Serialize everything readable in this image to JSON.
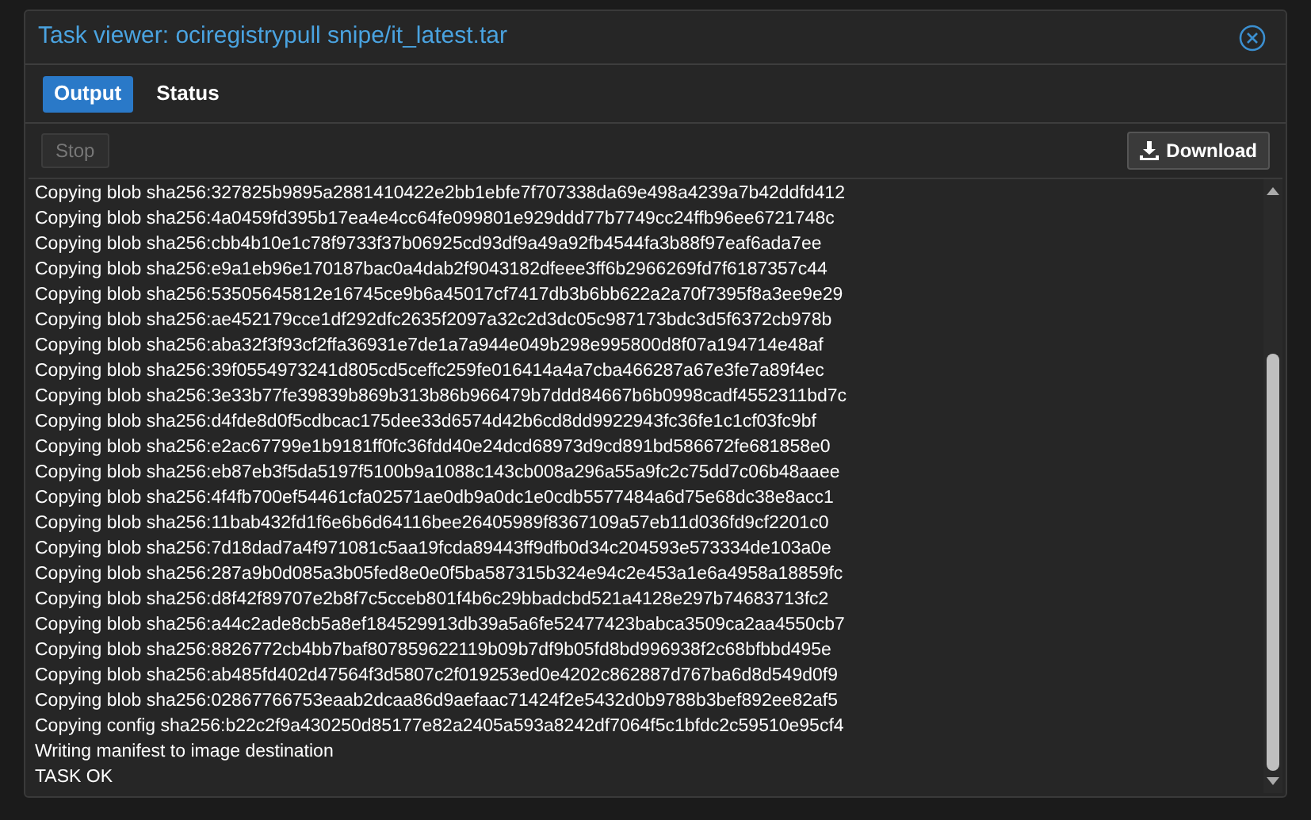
{
  "window": {
    "title": "Task viewer: ociregistrypull snipe/it_latest.tar"
  },
  "tabs": [
    {
      "label": "Output",
      "selected": true
    },
    {
      "label": "Status",
      "selected": false
    }
  ],
  "toolbar": {
    "stop": {
      "label": "Stop",
      "disabled": true
    },
    "download": {
      "label": "Download",
      "disabled": false
    }
  },
  "log": [
    "Copying blob sha256:327825b9895a2881410422e2bb1ebfe7f707338da69e498a4239a7b42ddfd412",
    "Copying blob sha256:4a0459fd395b17ea4e4cc64fe099801e929ddd77b7749cc24ffb96ee6721748c",
    "Copying blob sha256:cbb4b10e1c78f9733f37b06925cd93df9a49a92fb4544fa3b88f97eaf6ada7ee",
    "Copying blob sha256:e9a1eb96e170187bac0a4dab2f9043182dfeee3ff6b2966269fd7f6187357c44",
    "Copying blob sha256:53505645812e16745ce9b6a45017cf7417db3b6bb622a2a70f7395f8a3ee9e29",
    "Copying blob sha256:ae452179cce1df292dfc2635f2097a32c2d3dc05c987173bdc3d5f6372cb978b",
    "Copying blob sha256:aba32f3f93cf2ffa36931e7de1a7a944e049b298e995800d8f07a194714e48af",
    "Copying blob sha256:39f0554973241d805cd5ceffc259fe016414a4a7cba466287a67e3fe7a89f4ec",
    "Copying blob sha256:3e33b77fe39839b869b313b86b966479b7ddd84667b6b0998cadf4552311bd7c",
    "Copying blob sha256:d4fde8d0f5cdbcac175dee33d6574d42b6cd8dd9922943fc36fe1c1cf03fc9bf",
    "Copying blob sha256:e2ac67799e1b9181ff0fc36fdd40e24dcd68973d9cd891bd586672fe681858e0",
    "Copying blob sha256:eb87eb3f5da5197f5100b9a1088c143cb008a296a55a9fc2c75dd7c06b48aaee",
    "Copying blob sha256:4f4fb700ef54461cfa02571ae0db9a0dc1e0cdb5577484a6d75e68dc38e8acc1",
    "Copying blob sha256:11bab432fd1f6e6b6d64116bee26405989f8367109a57eb11d036fd9cf2201c0",
    "Copying blob sha256:7d18dad7a4f971081c5aa19fcda89443ff9dfb0d34c204593e573334de103a0e",
    "Copying blob sha256:287a9b0d085a3b05fed8e0e0f5ba587315b324e94c2e453a1e6a4958a18859fc",
    "Copying blob sha256:d8f42f89707e2b8f7c5cceb801f4b6c29bbadcbd521a4128e297b74683713fc2",
    "Copying blob sha256:a44c2ade8cb5a8ef184529913db39a5a6fe52477423babca3509ca2aa4550cb7",
    "Copying blob sha256:8826772cb4bb7baf807859622119b09b7df9b05fd8bd996938f2c68bfbbd495e",
    "Copying blob sha256:ab485fd402d47564f3d5807c2f019253ed0e4202c862887d767ba6d8d549d0f9",
    "Copying blob sha256:02867766753eaab2dcaa86d9aefaac71424f2e5432d0b9788b3bef892ee82af5",
    "Copying config sha256:b22c2f9a430250d85177e82a2405a593a8242df7064f5c1bfdc2c59510e95cf4",
    "Writing manifest to image destination",
    "TASK OK"
  ]
}
